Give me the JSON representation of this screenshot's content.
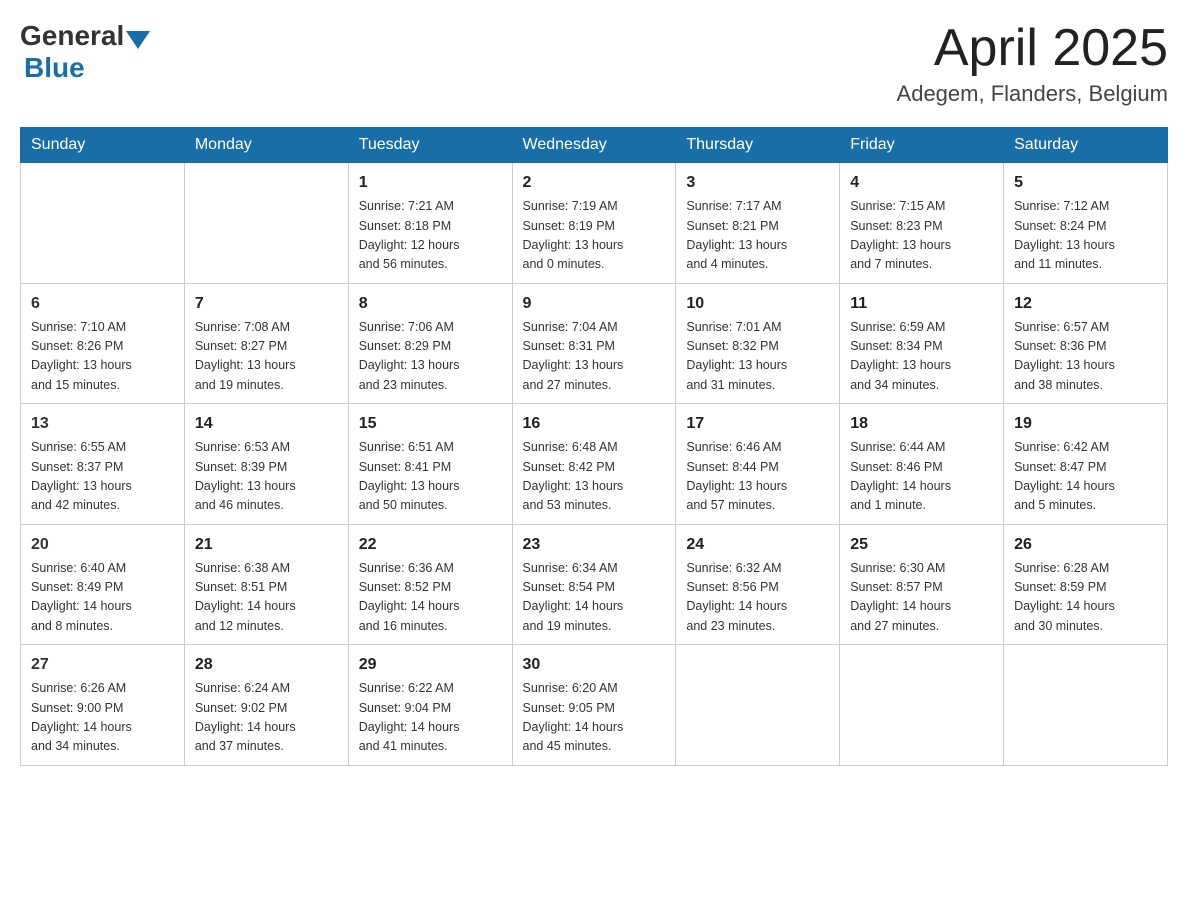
{
  "logo": {
    "general": "General",
    "blue": "Blue"
  },
  "title": "April 2025",
  "location": "Adegem, Flanders, Belgium",
  "days_header": [
    "Sunday",
    "Monday",
    "Tuesday",
    "Wednesday",
    "Thursday",
    "Friday",
    "Saturday"
  ],
  "weeks": [
    [
      {
        "day": "",
        "info": ""
      },
      {
        "day": "",
        "info": ""
      },
      {
        "day": "1",
        "info": "Sunrise: 7:21 AM\nSunset: 8:18 PM\nDaylight: 12 hours\nand 56 minutes."
      },
      {
        "day": "2",
        "info": "Sunrise: 7:19 AM\nSunset: 8:19 PM\nDaylight: 13 hours\nand 0 minutes."
      },
      {
        "day": "3",
        "info": "Sunrise: 7:17 AM\nSunset: 8:21 PM\nDaylight: 13 hours\nand 4 minutes."
      },
      {
        "day": "4",
        "info": "Sunrise: 7:15 AM\nSunset: 8:23 PM\nDaylight: 13 hours\nand 7 minutes."
      },
      {
        "day": "5",
        "info": "Sunrise: 7:12 AM\nSunset: 8:24 PM\nDaylight: 13 hours\nand 11 minutes."
      }
    ],
    [
      {
        "day": "6",
        "info": "Sunrise: 7:10 AM\nSunset: 8:26 PM\nDaylight: 13 hours\nand 15 minutes."
      },
      {
        "day": "7",
        "info": "Sunrise: 7:08 AM\nSunset: 8:27 PM\nDaylight: 13 hours\nand 19 minutes."
      },
      {
        "day": "8",
        "info": "Sunrise: 7:06 AM\nSunset: 8:29 PM\nDaylight: 13 hours\nand 23 minutes."
      },
      {
        "day": "9",
        "info": "Sunrise: 7:04 AM\nSunset: 8:31 PM\nDaylight: 13 hours\nand 27 minutes."
      },
      {
        "day": "10",
        "info": "Sunrise: 7:01 AM\nSunset: 8:32 PM\nDaylight: 13 hours\nand 31 minutes."
      },
      {
        "day": "11",
        "info": "Sunrise: 6:59 AM\nSunset: 8:34 PM\nDaylight: 13 hours\nand 34 minutes."
      },
      {
        "day": "12",
        "info": "Sunrise: 6:57 AM\nSunset: 8:36 PM\nDaylight: 13 hours\nand 38 minutes."
      }
    ],
    [
      {
        "day": "13",
        "info": "Sunrise: 6:55 AM\nSunset: 8:37 PM\nDaylight: 13 hours\nand 42 minutes."
      },
      {
        "day": "14",
        "info": "Sunrise: 6:53 AM\nSunset: 8:39 PM\nDaylight: 13 hours\nand 46 minutes."
      },
      {
        "day": "15",
        "info": "Sunrise: 6:51 AM\nSunset: 8:41 PM\nDaylight: 13 hours\nand 50 minutes."
      },
      {
        "day": "16",
        "info": "Sunrise: 6:48 AM\nSunset: 8:42 PM\nDaylight: 13 hours\nand 53 minutes."
      },
      {
        "day": "17",
        "info": "Sunrise: 6:46 AM\nSunset: 8:44 PM\nDaylight: 13 hours\nand 57 minutes."
      },
      {
        "day": "18",
        "info": "Sunrise: 6:44 AM\nSunset: 8:46 PM\nDaylight: 14 hours\nand 1 minute."
      },
      {
        "day": "19",
        "info": "Sunrise: 6:42 AM\nSunset: 8:47 PM\nDaylight: 14 hours\nand 5 minutes."
      }
    ],
    [
      {
        "day": "20",
        "info": "Sunrise: 6:40 AM\nSunset: 8:49 PM\nDaylight: 14 hours\nand 8 minutes."
      },
      {
        "day": "21",
        "info": "Sunrise: 6:38 AM\nSunset: 8:51 PM\nDaylight: 14 hours\nand 12 minutes."
      },
      {
        "day": "22",
        "info": "Sunrise: 6:36 AM\nSunset: 8:52 PM\nDaylight: 14 hours\nand 16 minutes."
      },
      {
        "day": "23",
        "info": "Sunrise: 6:34 AM\nSunset: 8:54 PM\nDaylight: 14 hours\nand 19 minutes."
      },
      {
        "day": "24",
        "info": "Sunrise: 6:32 AM\nSunset: 8:56 PM\nDaylight: 14 hours\nand 23 minutes."
      },
      {
        "day": "25",
        "info": "Sunrise: 6:30 AM\nSunset: 8:57 PM\nDaylight: 14 hours\nand 27 minutes."
      },
      {
        "day": "26",
        "info": "Sunrise: 6:28 AM\nSunset: 8:59 PM\nDaylight: 14 hours\nand 30 minutes."
      }
    ],
    [
      {
        "day": "27",
        "info": "Sunrise: 6:26 AM\nSunset: 9:00 PM\nDaylight: 14 hours\nand 34 minutes."
      },
      {
        "day": "28",
        "info": "Sunrise: 6:24 AM\nSunset: 9:02 PM\nDaylight: 14 hours\nand 37 minutes."
      },
      {
        "day": "29",
        "info": "Sunrise: 6:22 AM\nSunset: 9:04 PM\nDaylight: 14 hours\nand 41 minutes."
      },
      {
        "day": "30",
        "info": "Sunrise: 6:20 AM\nSunset: 9:05 PM\nDaylight: 14 hours\nand 45 minutes."
      },
      {
        "day": "",
        "info": ""
      },
      {
        "day": "",
        "info": ""
      },
      {
        "day": "",
        "info": ""
      }
    ]
  ]
}
